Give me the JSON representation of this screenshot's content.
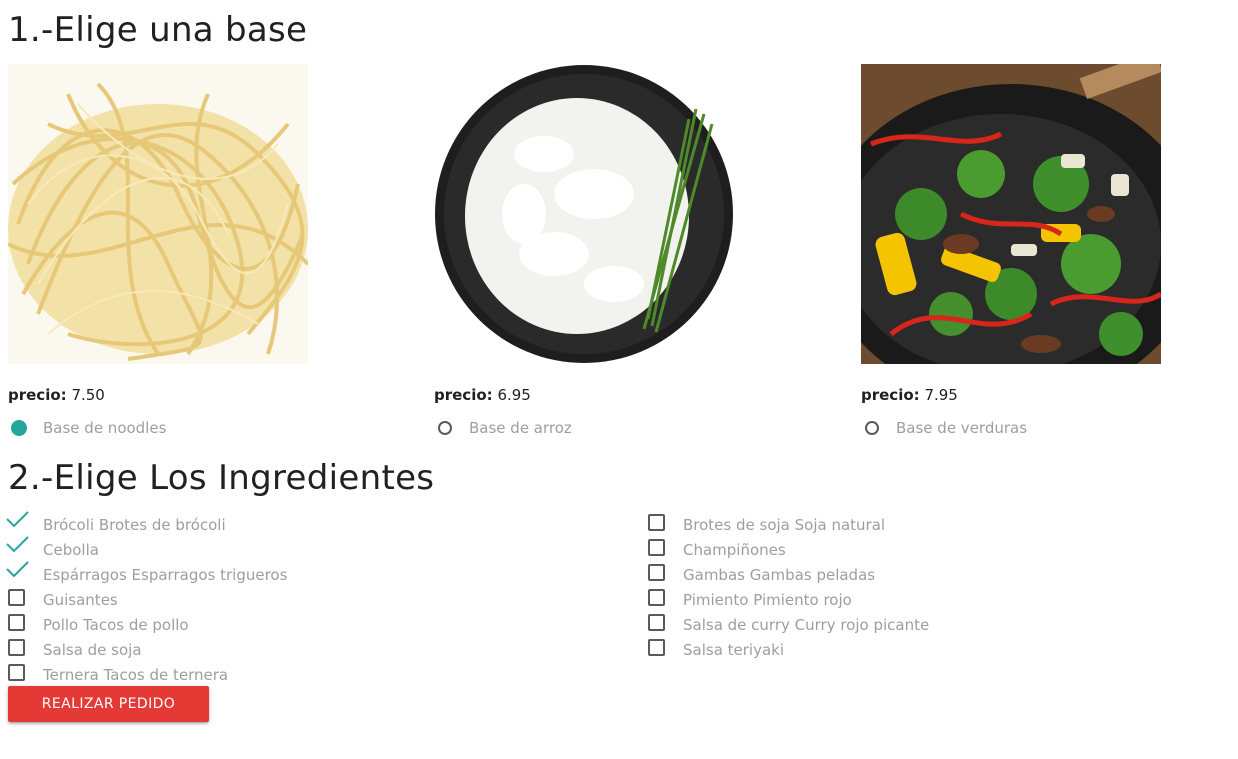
{
  "section1": {
    "title": "1.-Elige una base"
  },
  "bases": [
    {
      "price_label": "precio:",
      "price": "7.50",
      "label": "Base de noodles",
      "checked": true
    },
    {
      "price_label": "precio:",
      "price": "6.95",
      "label": "Base de arroz",
      "checked": false
    },
    {
      "price_label": "precio:",
      "price": "7.95",
      "label": "Base de verduras",
      "checked": false
    }
  ],
  "section2": {
    "title": "2.-Elige Los Ingredientes"
  },
  "ingredients_left": [
    {
      "label": "Brócoli Brotes de brócoli",
      "checked": true
    },
    {
      "label": "Cebolla",
      "checked": true
    },
    {
      "label": "Espárragos Esparragos trigueros",
      "checked": true
    },
    {
      "label": "Guisantes",
      "checked": false
    },
    {
      "label": "Pollo Tacos de pollo",
      "checked": false
    },
    {
      "label": "Salsa de soja",
      "checked": false
    },
    {
      "label": "Ternera Tacos de ternera",
      "checked": false
    }
  ],
  "ingredients_right": [
    {
      "label": "Brotes de soja Soja natural",
      "checked": false
    },
    {
      "label": "Champiñones",
      "checked": false
    },
    {
      "label": "Gambas Gambas peladas",
      "checked": false
    },
    {
      "label": "Pimiento Pimiento rojo",
      "checked": false
    },
    {
      "label": "Salsa de curry Curry rojo picante",
      "checked": false
    },
    {
      "label": "Salsa teriyaki",
      "checked": false
    }
  ],
  "order_button": {
    "label": "REALIZAR PEDIDO"
  },
  "colors": {
    "accent": "#26a69a",
    "button": "#e53935",
    "label_gray": "#9e9e9e"
  }
}
